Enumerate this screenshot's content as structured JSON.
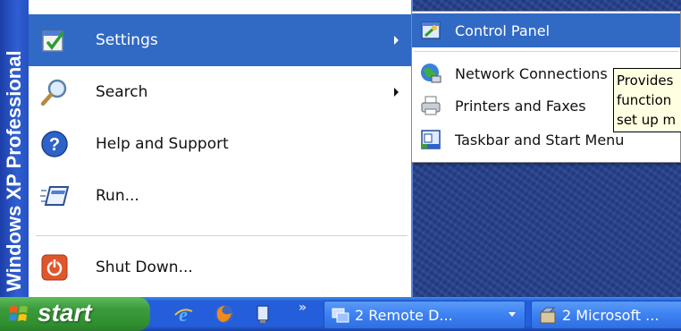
{
  "start_menu": {
    "banner_text": "Windows XP Professional",
    "items": [
      {
        "label": "Settings",
        "icon": "settings-icon",
        "has_submenu": true,
        "selected": true
      },
      {
        "label": "Search",
        "icon": "search-icon",
        "has_submenu": true,
        "selected": false
      },
      {
        "label": "Help and Support",
        "icon": "help-icon",
        "has_submenu": false,
        "selected": false
      },
      {
        "label": "Run...",
        "icon": "run-icon",
        "has_submenu": false,
        "selected": false
      },
      {
        "label": "Shut Down...",
        "icon": "shutdown-icon",
        "has_submenu": false,
        "selected": false
      }
    ]
  },
  "settings_submenu": {
    "items": [
      {
        "label": "Control Panel",
        "icon": "control-panel-icon",
        "selected": true
      },
      {
        "label": "Network Connections",
        "icon": "network-connections-icon",
        "selected": false
      },
      {
        "label": "Printers and Faxes",
        "icon": "printers-faxes-icon",
        "selected": false
      },
      {
        "label": "Taskbar and Start Menu",
        "icon": "taskbar-start-menu-icon",
        "selected": false
      }
    ]
  },
  "tooltip": {
    "lines": [
      "Provides",
      "function",
      "set up m"
    ]
  },
  "taskbar": {
    "start_label": "start",
    "quick_launch": [
      "internet-explorer-icon",
      "firefox-icon",
      "show-desktop-icon"
    ],
    "overflow_label": "»",
    "buttons": [
      {
        "label": "2 Remote D...",
        "icon": "remote-desktop-icon"
      },
      {
        "label": "2 Microsoft ...",
        "icon": "microsoft-app-icon"
      }
    ]
  },
  "colors": {
    "selection": "#316ac5",
    "taskbar": "#245edb",
    "start_button": "#3c9c3c",
    "banner": "#2550c2",
    "tooltip_bg": "#ffffe1"
  }
}
